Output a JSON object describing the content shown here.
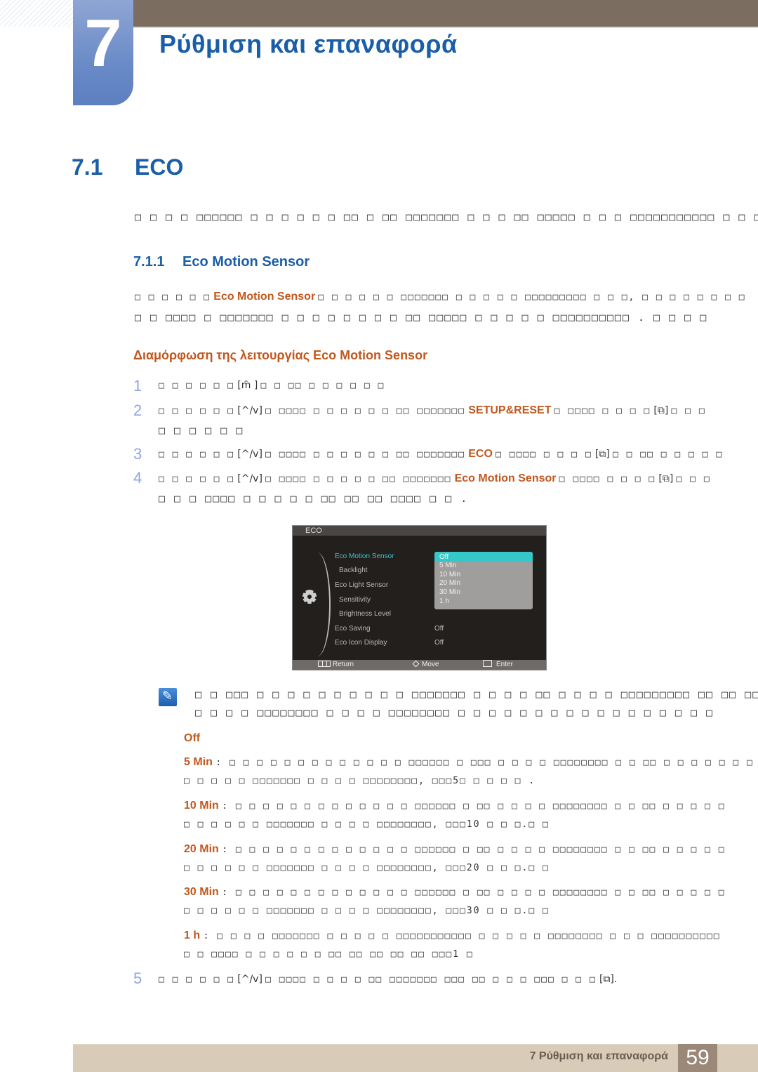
{
  "chapter": {
    "number": "7",
    "title": "Ρύθμιση και επαναφορά"
  },
  "section": {
    "number": "7.1",
    "title": "ECO",
    "intro": "□ □ □ □ □□□□□□ □ □ □ □ □ □ □□ □ □□ □□□□□□□ □ □ □ □□ □□□□□ □ □ □ □□□□□□□□□□□ □ □ □ ."
  },
  "subsection": {
    "number": "7.1.1",
    "title": "Eco Motion Sensor",
    "desc_line1_pre": "□ □ □ □ □ □",
    "desc_line1_hl": "Eco Motion Sensor",
    "desc_line1_post": "□ □ □ □ □ □ □□□□□□□ □ □ □ □ □ □□□□□□□□□ □ □ □, □ □ □ □ □ □ □ □",
    "desc_line2": "□ □ □□□□ □ □□□□□□□ □ □ □ □ □ □ □ □ □□ □□□□□ □ □ □ □ □ □□□□□□□□□□ . □ □ □ □"
  },
  "procedure": {
    "title": "Διαμόρφωση της λειτουργίας Eco Motion Sensor",
    "steps": [
      {
        "num": "1",
        "pre": "□ □ □ □ □ □",
        "key": "[m̄ ]",
        "post": "□ □ □□ □ □ □ □ □ □",
        "line2": ""
      },
      {
        "num": "2",
        "pre": "□ □ □ □ □ □",
        "key": "[^/v]",
        "mid": "□ □□□□ □ □ □ □ □ □ □□ □□□□□□□",
        "hl": "SETUP&RESET",
        "post": "□ □□□□ □ □ □ □",
        "key2": "[⧉]",
        "post2": "□ □ □",
        "line2": "□ □ □ □ □ □"
      },
      {
        "num": "3",
        "pre": "□ □ □ □ □ □",
        "key": "[^/v]",
        "mid": "□ □□□□ □ □ □ □ □ □ □□ □□□□□□□",
        "hl": "ECO",
        "post": "□ □□□□ □ □ □ □",
        "key2": "[⧉]",
        "post2": "□ □ □□ □ □ □ □ □",
        "line2": ""
      },
      {
        "num": "4",
        "pre": "□ □ □ □ □ □",
        "key": "[^/v]",
        "mid": "□ □□□□ □ □ □ □ □ □□ □□□□□□□",
        "hl": "Eco Motion Sensor",
        "post": "□ □□□□ □ □ □ □",
        "key2": "[⧉]",
        "post2": "□ □ □",
        "line2": "□ □ □ □□□□ □ □ □ □ □ □□ □□ □□ □□□□ □ □ ."
      },
      {
        "num": "5",
        "pre": "□ □ □ □ □ □",
        "key": "[^/v]",
        "mid": "□ □□□□ □ □ □ □ □□ □□□□□□□ □□□ □□ □ □ □ □□□ □ □ □",
        "key2": "[⧉].",
        "line2": ""
      }
    ]
  },
  "osd": {
    "title": "ECO",
    "items": [
      {
        "label": "Eco Motion Sensor",
        "active": true
      },
      {
        "label": "Backlight"
      },
      {
        "label": "Eco Light Sensor"
      },
      {
        "label": "Sensitivity"
      },
      {
        "label": "Brightness Level"
      },
      {
        "label": "Eco Saving",
        "value": "Off"
      },
      {
        "label": "Eco Icon Display",
        "value": "Off"
      }
    ],
    "dropdown_options": [
      "Off",
      "5 Min",
      "10 Min",
      "20 Min",
      "30 Min",
      "1 h"
    ],
    "selected_option": "Off",
    "footer": {
      "return": "Return",
      "move": "Move",
      "enter": "Enter"
    },
    "colors": {
      "accent": "#35c8c8",
      "background": "#231f1d"
    }
  },
  "note": {
    "line1": "□ □ □□□ □ □ □ □ □ □ □ □ □ □ □□□□□□□ □ □ □ □ □□ □ □ □ □ □□□□□□□□□ □□ □□ □□□□ □",
    "line2": "□ □ □ □ □□□□□□□□ □ □ □ □ □□□□□□□□ □ □ □ □ □ □ □ □ □ □ □ □ □ □ □ □ □"
  },
  "options": [
    {
      "label": "Off",
      "text": "",
      "line2": ""
    },
    {
      "label": "5 Min",
      "text": ": □ □ □ □ □ □ □ □ □ □ □ □ □ □□□□□□ □ □□□ □ □ □ □ □□□□□□□□ □ □ □□ □ □ □ □ □ □ □",
      "line2": "□ □ □ □ □ □□□□□□□ □ □ □ □ □□□□□□□□, □□□5□ □ □ □ □ ."
    },
    {
      "label": "10 Min",
      "text": ": □ □ □ □ □ □ □ □ □ □ □ □ □ □□□□□□ □ □□ □ □ □ □ □□□□□□□□ □ □ □□ □ □ □ □ □",
      "line2": "□ □ □ □ □ □ □□□□□□□ □ □ □ □ □□□□□□□□, □□□10 □ □ □.□ □"
    },
    {
      "label": "20 Min",
      "text": ": □ □ □ □ □ □ □ □ □ □ □ □ □ □□□□□□ □ □□ □ □ □ □ □□□□□□□□ □ □ □□ □ □ □ □ □",
      "line2": "□ □ □ □ □ □ □□□□□□□ □ □ □ □ □□□□□□□□, □□□20 □ □ □.□ □"
    },
    {
      "label": "30 Min",
      "text": ": □ □ □ □ □ □ □ □ □ □ □ □ □ □□□□□□ □ □□ □ □ □ □ □□□□□□□□ □ □ □□ □ □ □ □ □",
      "line2": "□ □ □ □ □ □ □□□□□□□ □ □ □ □ □□□□□□□□, □□□30 □ □ □.□ □"
    },
    {
      "label": "1 h",
      "text": ": □ □ □ □ □□□□□□□ □ □ □ □ □ □□□□□□□□□□□ □ □ □ □ □ □□□□□□□□ □ □ □ □□□□□□□□□□",
      "line2": "□ □ □□□□ □ □ □ □ □ □ □□ □□ □□ □□ □□ □□□1 □"
    }
  ],
  "footer": {
    "text": "7 Ρύθμιση και επαναφορά",
    "page": "59"
  }
}
